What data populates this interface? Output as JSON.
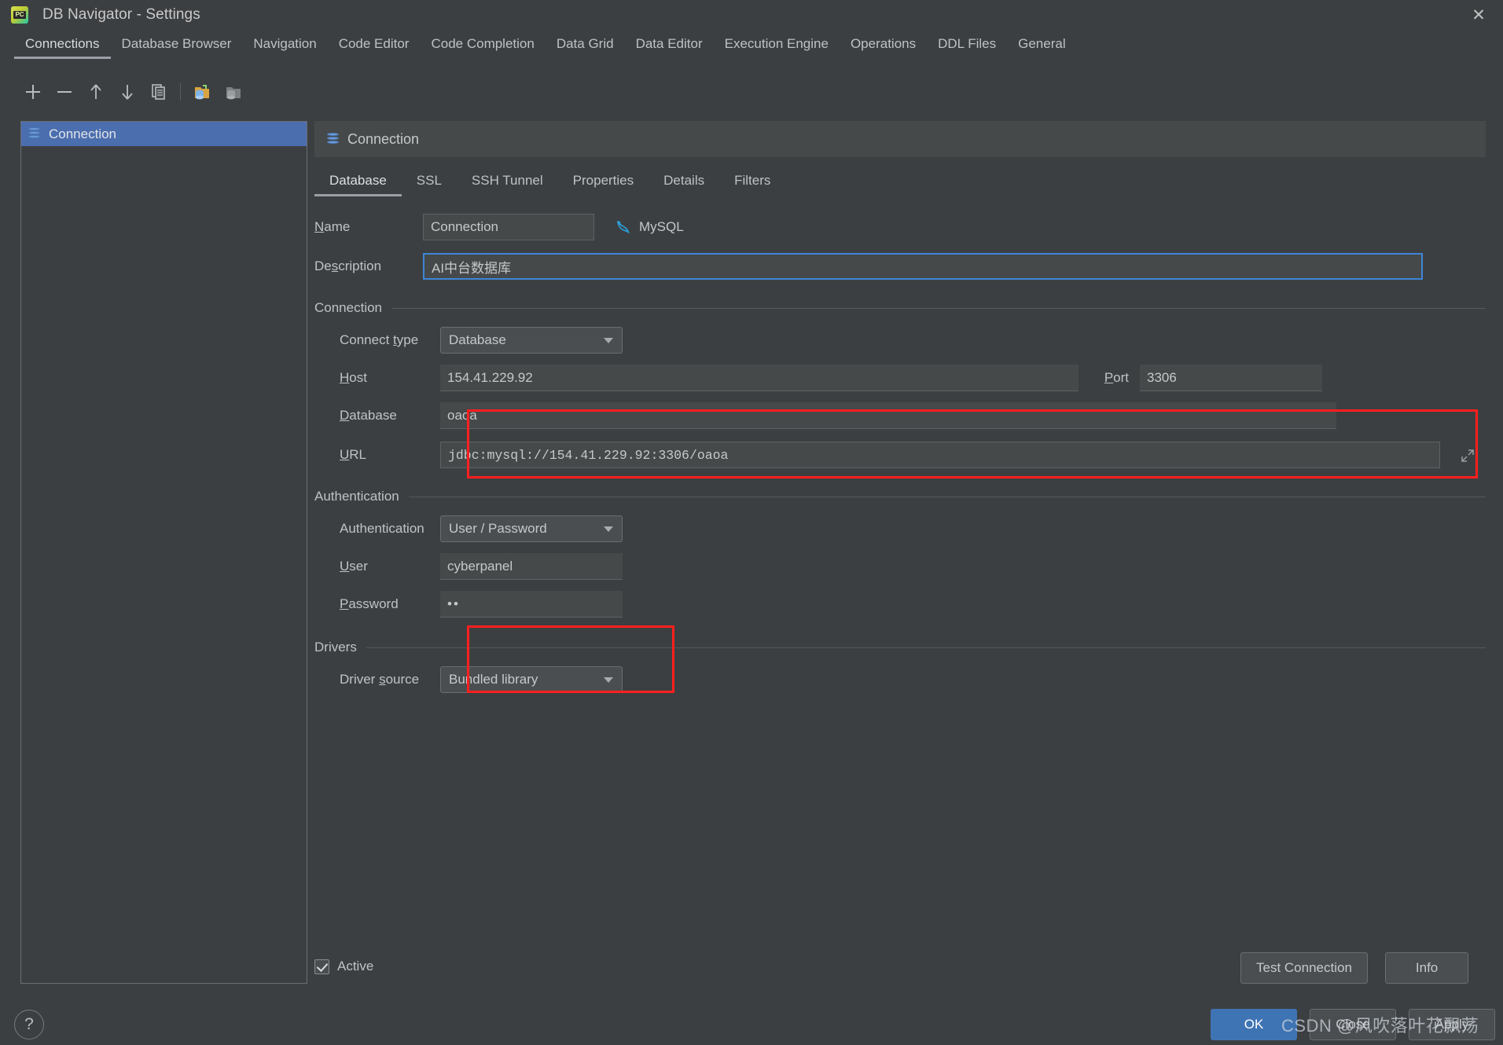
{
  "window": {
    "title": "DB Navigator - Settings",
    "app_icon": "pycharm-icon",
    "close_label": "✕"
  },
  "top_tabs": [
    {
      "label": "Connections",
      "active": true
    },
    {
      "label": "Database Browser",
      "active": false
    },
    {
      "label": "Navigation",
      "active": false
    },
    {
      "label": "Code Editor",
      "active": false
    },
    {
      "label": "Code Completion",
      "active": false
    },
    {
      "label": "Data Grid",
      "active": false
    },
    {
      "label": "Data Editor",
      "active": false
    },
    {
      "label": "Execution Engine",
      "active": false
    },
    {
      "label": "Operations",
      "active": false
    },
    {
      "label": "DDL Files",
      "active": false
    },
    {
      "label": "General",
      "active": false
    }
  ],
  "toolbar": {
    "add": "add-connection",
    "remove": "remove-connection",
    "move_up": "move-up",
    "move_down": "move-down",
    "duplicate": "duplicate-connection",
    "import": "import-connection",
    "export": "export-connection"
  },
  "connection_list": {
    "items": [
      {
        "label": "Connection",
        "icon": "database-icon",
        "selected": true
      }
    ]
  },
  "panel": {
    "header_title": "Connection",
    "sub_tabs": [
      {
        "label": "Database",
        "active": true
      },
      {
        "label": "SSL",
        "active": false
      },
      {
        "label": "SSH Tunnel",
        "active": false
      },
      {
        "label": "Properties",
        "active": false
      },
      {
        "label": "Details",
        "active": false
      },
      {
        "label": "Filters",
        "active": false
      }
    ]
  },
  "form": {
    "name_label": "Name",
    "name_value": "Connection",
    "db_type_label": "MySQL",
    "db_type_icon": "mysql-dolphin-icon",
    "description_label": "Description",
    "description_value": "AI中台数据库",
    "connection_section": "Connection",
    "connect_type_label": "Connect type",
    "connect_type_value": "Database",
    "host_label": "Host",
    "host_value": "154.41.229.92",
    "port_label": "Port",
    "port_value": "3306",
    "database_label": "Database",
    "database_value": "oaoa",
    "url_label": "URL",
    "url_value": "jdbc:mysql://154.41.229.92:3306/oaoa",
    "url_expand_icon": "expand-icon",
    "authentication_section": "Authentication",
    "authentication_label": "Authentication",
    "authentication_value": "User / Password",
    "user_label": "User",
    "user_value": "cyberpanel",
    "password_label": "Password",
    "password_value": "••",
    "drivers_section": "Drivers",
    "driver_source_label": "Driver source",
    "driver_source_value": "Bundled library"
  },
  "footer": {
    "active_label": "Active",
    "active_checked": true,
    "test_connection_label": "Test Connection",
    "info_label": "Info",
    "ok_label": "OK",
    "close_label": "Close",
    "apply_label": "Apply",
    "help_label": "?"
  },
  "watermark": "CSDN @风吹落叶花飘荡",
  "colors": {
    "background": "#3c3f41",
    "panel": "#45494a",
    "selection": "#4b6eaf",
    "accent_button": "#3f74b4",
    "annotation": "#ff1f1f",
    "focus_border": "#3d86d6"
  }
}
